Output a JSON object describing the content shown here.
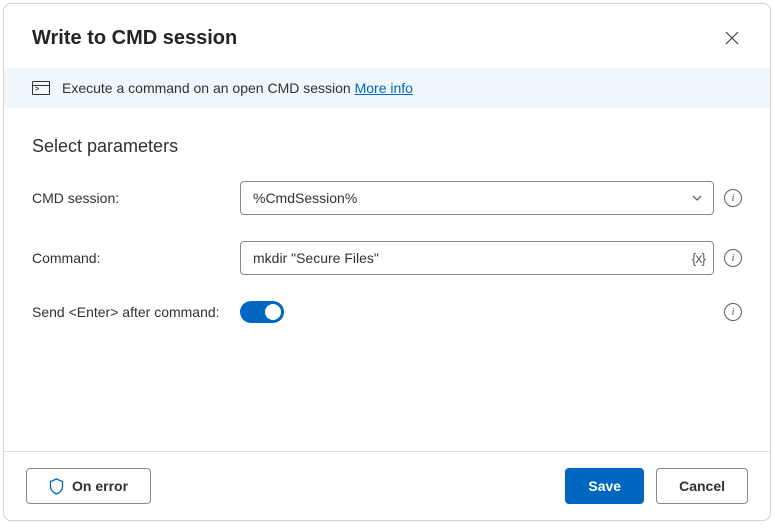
{
  "header": {
    "title": "Write to CMD session"
  },
  "info": {
    "text": "Execute a command on an open CMD session",
    "link": "More info"
  },
  "section": {
    "title": "Select parameters"
  },
  "fields": {
    "cmd_session": {
      "label": "CMD session:",
      "value": "%CmdSession%"
    },
    "command": {
      "label": "Command:",
      "value": "mkdir \"Secure Files\""
    },
    "send_enter": {
      "label": "Send <Enter> after command:",
      "value": true
    }
  },
  "footer": {
    "on_error": "On error",
    "save": "Save",
    "cancel": "Cancel"
  }
}
